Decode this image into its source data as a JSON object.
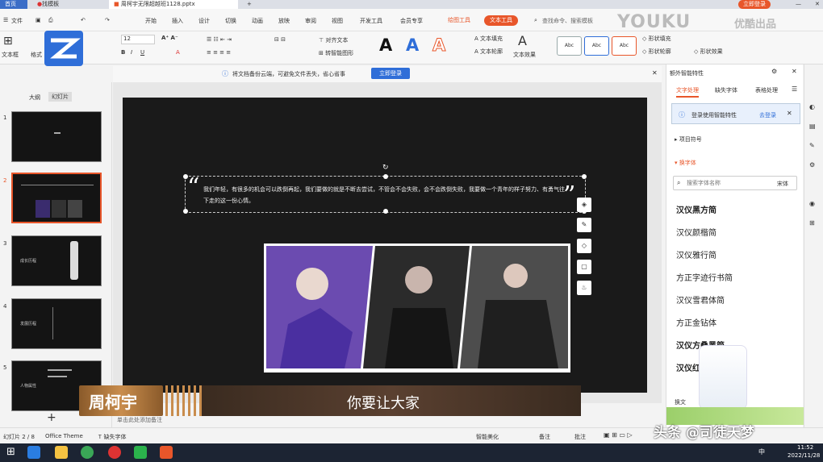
{
  "tabs": {
    "home": "首页",
    "templates": "找模板",
    "doc": "周柯宇无限超越班1128.pptx",
    "plus": "+"
  },
  "window": {
    "login": "立即登录"
  },
  "menus": [
    "文件",
    "开始",
    "插入",
    "设计",
    "切换",
    "动画",
    "放映",
    "审阅",
    "视图",
    "开发工具",
    "会员专享"
  ],
  "drawing_tools": "绘图工具",
  "text_tools": "文本工具",
  "search_placeholder": "查找命令、搜索模板",
  "watermark": {
    "youku": "YOUKU",
    "youku_cn": "优酷出品"
  },
  "ribbon": {
    "textbox": "文本框",
    "format": "格式",
    "font_size": "12",
    "align_text": "对齐文本",
    "convert_art": "转智能图形",
    "text_fill": "文本填充",
    "text_outline": "文本轮廓",
    "text_effect": "文本效果",
    "shape_fill": "形状填充",
    "shape_outline": "形状轮廓",
    "shape_effect": "形状效果",
    "art_letter": "A",
    "shape_label": "Abc"
  },
  "notice": {
    "text": "将文档备份云端，可避免文件丢失，省心省事",
    "button": "立即登录"
  },
  "left": {
    "outline_tab": "大纲",
    "slides_tab": "幻灯片",
    "slide_nums": [
      "1",
      "2",
      "3",
      "4",
      "5"
    ],
    "add": "+"
  },
  "thumb3": {
    "title": "成长历程"
  },
  "thumb4": {
    "title": "发展历程"
  },
  "thumb5": {
    "title": "人物属性"
  },
  "slide": {
    "quote": "我们年轻，有很多的机会可以跌倒再起，我们要做的就是不断去尝试，不管会不会失败，会不会跌倒失败，我要做一个青年的样子努力、有勇气往下走的这一份心情。",
    "open_quote": "“",
    "close_quote": "”"
  },
  "caption": {
    "name": "周柯宇",
    "subtitle": "你要让大家"
  },
  "notes_placeholder": "单击此处添加备注",
  "right": {
    "header": "额外智能特性",
    "tabs": [
      "文字处理",
      "缺失字体",
      "表格处理"
    ],
    "login_tip": "登录使用智能特性",
    "login_link": "去登录",
    "section1": "项目符号",
    "section2": "换字体",
    "search_placeholder": "搜索字体名称",
    "default_font": "宋体",
    "fonts": [
      "汉仪黑方简",
      "汉仪颜楷简",
      "汉仪雅行简",
      "方正字迹行书简",
      "汉仪雪君体简",
      "方正金钻体",
      "汉仪方叠黑简",
      "汉仪红"
    ],
    "replace": "换文"
  },
  "status": {
    "slide_count": "幻灯片 2 / 8",
    "theme": "Office Theme",
    "missing_font": "缺失字体",
    "smart_beauty": "智能美化",
    "notes": "备注",
    "comments": "批注"
  },
  "taskbar": {
    "time": "11:52",
    "date": "2022/11/28",
    "ime": "中"
  },
  "credit": "头条 @司徒天梦",
  "colors": {
    "accent": "#e8562a",
    "blue": "#2f6ed8",
    "slide_bg": "#1a1a1a"
  }
}
